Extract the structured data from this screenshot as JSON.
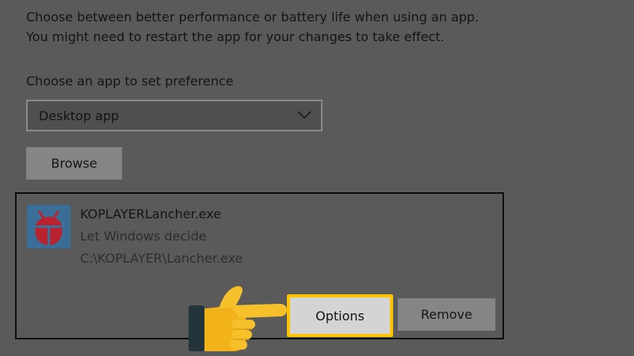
{
  "description": {
    "line1": "Choose between better performance or battery life when using an app.",
    "line2": "You might need to restart the app for your changes to take effect."
  },
  "preference": {
    "label": "Choose an app to set preference",
    "dropdown_value": "Desktop app",
    "browse_label": "Browse"
  },
  "app": {
    "name": "KOPLAYERLancher.exe",
    "preference": "Let Windows decide",
    "path": "C:\\KOPLAYER\\Lancher.exe",
    "options_label": "Options",
    "remove_label": "Remove"
  },
  "icons": {
    "app_icon": "koplayer-app-icon",
    "dropdown": "chevron-down-icon",
    "pointer": "pointing-hand-icon"
  },
  "colors": {
    "highlight": "#ffc400",
    "background": "#5a5a5a",
    "app_icon_bg": "#3a6e97",
    "app_icon_fg": "#b8232f"
  }
}
